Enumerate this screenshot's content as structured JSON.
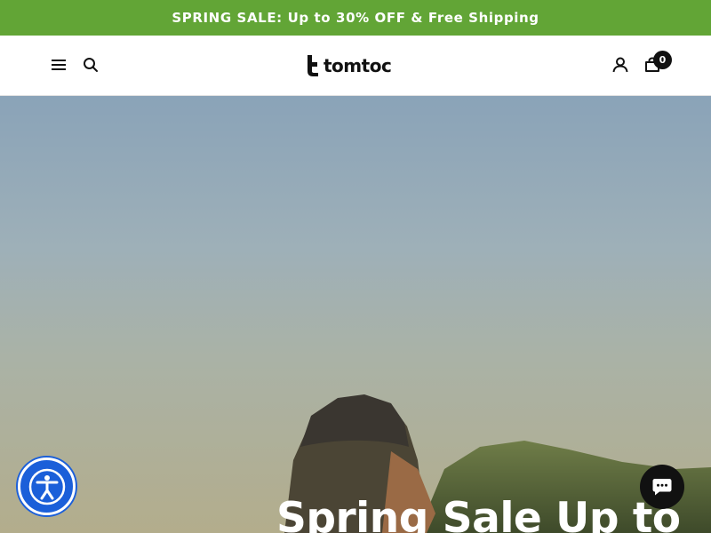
{
  "announcement": {
    "text": "SPRING SALE: Up to 30% OFF & Free Shipping"
  },
  "header": {
    "logo_text": "tomtoc",
    "menu_icon": "menu-icon",
    "search_icon": "search-icon",
    "account_icon": "user-icon",
    "cart_icon": "cart-icon",
    "cart_count": "0"
  },
  "hero": {
    "title": "Spring Sale Up to"
  },
  "widgets": {
    "accessibility_icon": "accessibility-icon",
    "chat_icon": "chat-icon"
  },
  "colors": {
    "announcement_bg": "#62a536",
    "accessibility_bg": "#1b5fd9",
    "chat_bg": "#111111"
  }
}
